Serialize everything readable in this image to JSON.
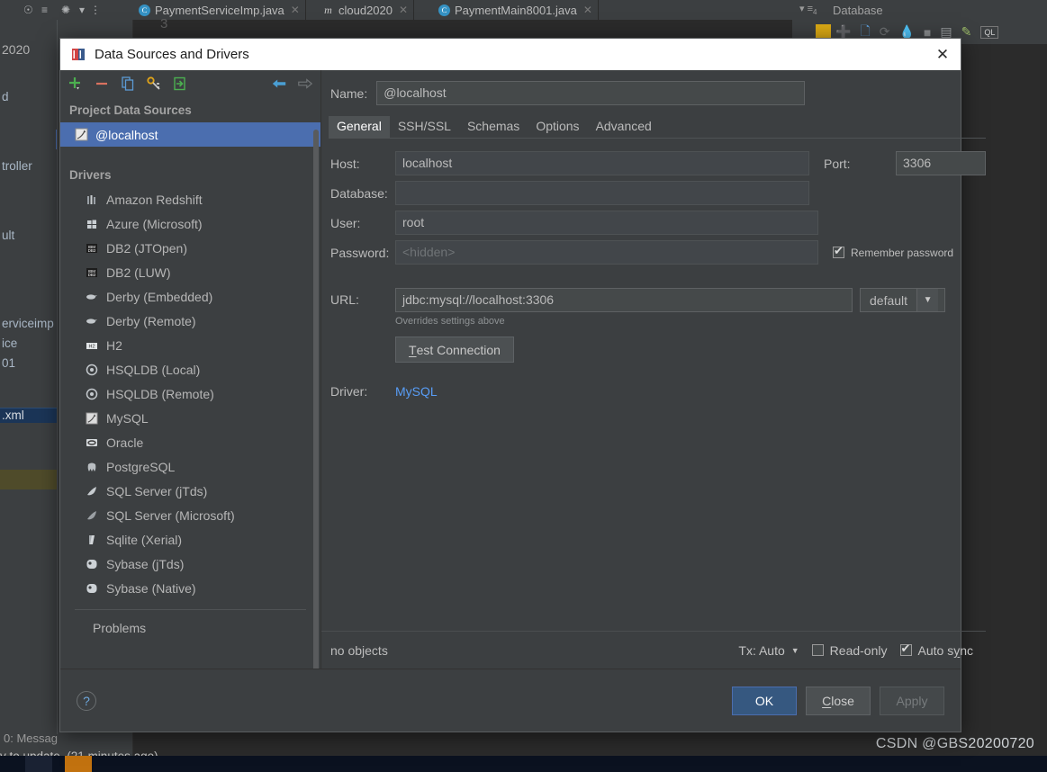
{
  "ide": {
    "editor_tabs": [
      {
        "label": "PaymentServiceImp.java",
        "icon": "java-class-icon"
      },
      {
        "label": "cloud2020",
        "icon": "maven-icon"
      },
      {
        "label": "PaymentMain8001.java",
        "icon": "java-class-icon"
      }
    ],
    "gutter_line_number": "3",
    "project_fragments": [
      "2020",
      "d",
      "troller",
      "ult",
      "erviceimp",
      "ice",
      "01",
      ".xml"
    ],
    "database_panel_title": "Database",
    "status_left": "0: Messag",
    "status_update": "y to update. (21 minutes ago)",
    "watermark": "CSDN @GBS20200720"
  },
  "dialog": {
    "title": "Data Sources and Drivers",
    "title_icon": "datasource-icon",
    "close_icon": "close-icon",
    "toolbar": [
      {
        "name": "add-button",
        "icon": "plus-icon"
      },
      {
        "name": "remove-button",
        "icon": "minus-icon"
      },
      {
        "name": "duplicate-button",
        "icon": "copy-icon"
      },
      {
        "name": "properties-button",
        "icon": "wrench-icon"
      },
      {
        "name": "import-button",
        "icon": "import-icon"
      },
      {
        "name": "back-button",
        "icon": "arrow-left-icon"
      },
      {
        "name": "forward-button",
        "icon": "arrow-right-icon"
      }
    ],
    "project_sources_header": "Project Data Sources",
    "data_sources": [
      {
        "label": "@localhost",
        "icon": "mysql-icon",
        "selected": true
      }
    ],
    "drivers_header": "Drivers",
    "drivers": [
      {
        "label": "Amazon Redshift",
        "icon": "redshift-icon"
      },
      {
        "label": "Azure (Microsoft)",
        "icon": "azure-icon"
      },
      {
        "label": "DB2 (JTOpen)",
        "icon": "db2-icon"
      },
      {
        "label": "DB2 (LUW)",
        "icon": "db2-icon"
      },
      {
        "label": "Derby (Embedded)",
        "icon": "derby-icon"
      },
      {
        "label": "Derby (Remote)",
        "icon": "derby-icon"
      },
      {
        "label": "H2",
        "icon": "h2-icon"
      },
      {
        "label": "HSQLDB (Local)",
        "icon": "hsqldb-icon"
      },
      {
        "label": "HSQLDB (Remote)",
        "icon": "hsqldb-icon"
      },
      {
        "label": "MySQL",
        "icon": "mysql-icon"
      },
      {
        "label": "Oracle",
        "icon": "oracle-icon"
      },
      {
        "label": "PostgreSQL",
        "icon": "postgres-icon"
      },
      {
        "label": "SQL Server (jTds)",
        "icon": "sqlserver-icon"
      },
      {
        "label": "SQL Server (Microsoft)",
        "icon": "sqlserver-icon"
      },
      {
        "label": "Sqlite (Xerial)",
        "icon": "sqlite-icon"
      },
      {
        "label": "Sybase (jTds)",
        "icon": "sybase-icon"
      },
      {
        "label": "Sybase (Native)",
        "icon": "sybase-icon"
      }
    ],
    "problems_label": "Problems",
    "name_label": "Name:",
    "name_value": "@localhost",
    "tabs": [
      {
        "label": "General",
        "active": true
      },
      {
        "label": "SSH/SSL",
        "active": false
      },
      {
        "label": "Schemas",
        "active": false
      },
      {
        "label": "Options",
        "active": false
      },
      {
        "label": "Advanced",
        "active": false
      }
    ],
    "fields": {
      "host_label": "Host:",
      "host_value": "localhost",
      "port_label": "Port:",
      "port_value": "3306",
      "database_label": "Database:",
      "database_value": "",
      "user_label": "User:",
      "user_value": "root",
      "password_label": "Password:",
      "password_placeholder": "<hidden>",
      "remember_password_label": "Remember password",
      "remember_password_checked": true,
      "url_label": "URL:",
      "url_value": "jdbc:mysql://localhost:3306",
      "url_hint": "Overrides settings above",
      "url_mode_value": "default",
      "test_connection_label": "Test Connection",
      "driver_label": "Driver:",
      "driver_value": "MySQL"
    },
    "status": {
      "objects": "no objects",
      "tx_label": "Tx: Auto",
      "read_only_label": "Read-only",
      "read_only_checked": false,
      "auto_sync_label": "Auto sync",
      "auto_sync_checked": true
    },
    "footer": {
      "help_label": "?",
      "ok_label": "OK",
      "close_label": "Close",
      "apply_label": "Apply",
      "apply_disabled": true
    }
  },
  "colors": {
    "dialog_bg": "#3c3f41",
    "selection_blue": "#4b6eaf",
    "primary_button": "#365880",
    "link_blue": "#589df6",
    "accent_green": "#4caf50"
  }
}
